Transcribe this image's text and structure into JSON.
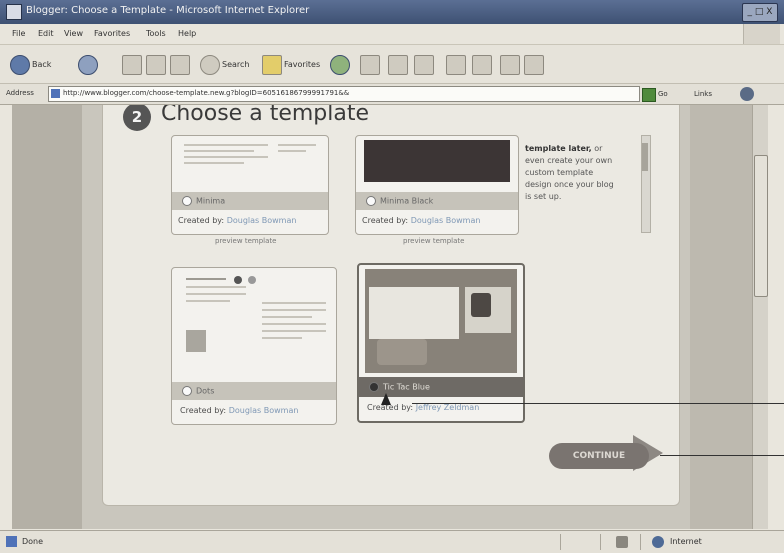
{
  "window": {
    "title": "Blogger: Choose a Template - Microsoft Internet Explorer",
    "controls": "_ □ X"
  },
  "menu": [
    "File",
    "Edit",
    "View",
    "Favorites",
    "Tools",
    "Help"
  ],
  "toolbar": {
    "back_label": "Back",
    "search_label": "Search",
    "favorites_label": "Favorites"
  },
  "address": {
    "label": "Address",
    "url": "http://www.blogger.com/choose-template.new.g?blogID=60516186799991791&&",
    "go_label": "Go",
    "links_label": "Links"
  },
  "page": {
    "step_number": "2",
    "heading": "Choose a template",
    "side_text_bold": "template later,",
    "side_text_rest": " or even create your own custom template design once your blog is set up.",
    "continue_label": "CONTINUE"
  },
  "templates": [
    {
      "name": "Minima",
      "created_prefix": "Created by:",
      "author": "Douglas Bowman",
      "preview": "preview template"
    },
    {
      "name": "Minima Black",
      "created_prefix": "Created by:",
      "author": "Douglas Bowman",
      "preview": "preview template"
    },
    {
      "name": "Dots",
      "created_prefix": "Created by:",
      "author": "Douglas Bowman"
    },
    {
      "name": "Tic Tac Blue",
      "created_prefix": "Created by:",
      "author": "Jeffrey Zeldman"
    }
  ],
  "status": {
    "text": "Done",
    "zone": "Internet"
  },
  "colors": {
    "titlebar": "#4a5d80",
    "continue_button": "#7a7470"
  }
}
